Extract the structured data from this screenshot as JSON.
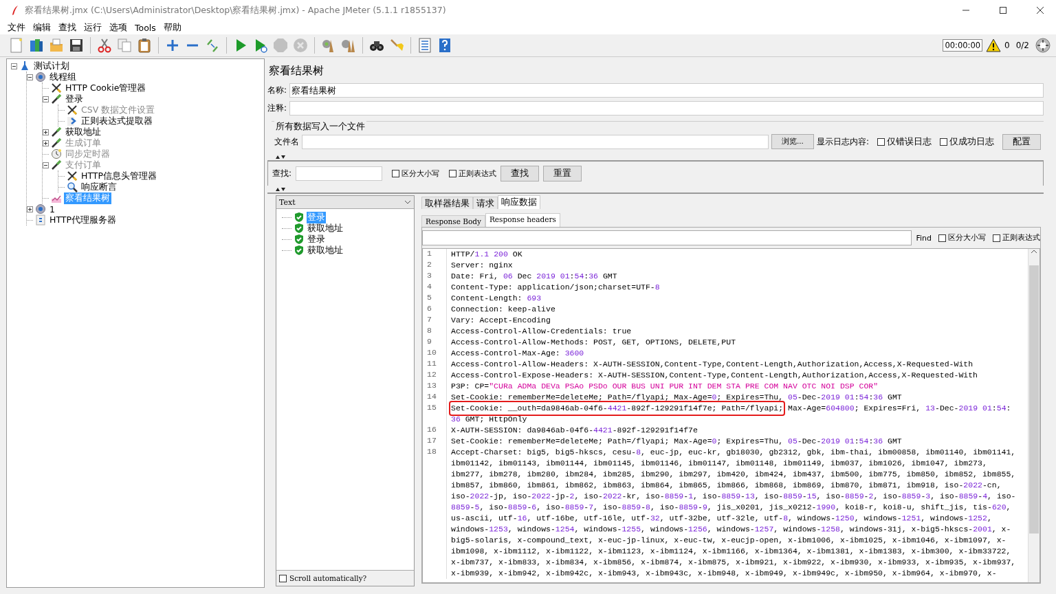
{
  "window": {
    "title": "察看结果树.jmx (C:\\Users\\Administrator\\Desktop\\察看结果树.jmx) - Apache JMeter (5.1.1 r1855137)"
  },
  "menu": [
    "文件",
    "编辑",
    "查找",
    "运行",
    "选项",
    "Tools",
    "帮助"
  ],
  "toolbar": [
    {
      "kind": "new",
      "disabled": false
    },
    {
      "kind": "templates",
      "disabled": false
    },
    {
      "kind": "open",
      "disabled": false
    },
    {
      "kind": "save",
      "disabled": false
    },
    {
      "kind": "separator"
    },
    {
      "kind": "cut",
      "disabled": false
    },
    {
      "kind": "copy",
      "disabled": false
    },
    {
      "kind": "paste",
      "disabled": false
    },
    {
      "kind": "separator"
    },
    {
      "kind": "expand",
      "disabled": false
    },
    {
      "kind": "collapse",
      "disabled": false
    },
    {
      "kind": "toggle",
      "disabled": false
    },
    {
      "kind": "separator"
    },
    {
      "kind": "start",
      "disabled": false
    },
    {
      "kind": "start-no-pauses",
      "disabled": false
    },
    {
      "kind": "stop",
      "disabled": true
    },
    {
      "kind": "shutdown",
      "disabled": true
    },
    {
      "kind": "separator"
    },
    {
      "kind": "clear",
      "disabled": false
    },
    {
      "kind": "clear-all",
      "disabled": false
    },
    {
      "kind": "separator"
    },
    {
      "kind": "search",
      "disabled": false
    },
    {
      "kind": "reset",
      "disabled": false
    },
    {
      "kind": "separator"
    },
    {
      "kind": "function-helper",
      "disabled": false
    },
    {
      "kind": "help",
      "disabled": false
    }
  ],
  "status": {
    "timer": "00:00:00",
    "errors": "0",
    "threads": "0/2"
  },
  "tree": [
    {
      "label": "测试计划",
      "kind": "plan",
      "disabled": false,
      "selected": false,
      "expanded": true,
      "children": [
        {
          "label": "线程组",
          "kind": "thread",
          "disabled": false,
          "selected": false,
          "expanded": true,
          "children": [
            {
              "label": "HTTP Cookie管理器",
              "kind": "config",
              "disabled": false,
              "selected": false
            },
            {
              "label": "登录",
              "kind": "sampler",
              "disabled": false,
              "selected": false,
              "expanded": true,
              "children": [
                {
                  "label": "CSV 数据文件设置",
                  "kind": "config",
                  "disabled": true,
                  "selected": false
                },
                {
                  "label": "正则表达式提取器",
                  "kind": "extractor",
                  "disabled": false,
                  "selected": false
                }
              ]
            },
            {
              "label": "获取地址",
              "kind": "sampler",
              "disabled": false,
              "selected": false,
              "expanded": false
            },
            {
              "label": "生成订单",
              "kind": "sampler",
              "disabled": true,
              "selected": false,
              "expanded": false
            },
            {
              "label": "同步定时器",
              "kind": "timer",
              "disabled": true,
              "selected": false
            },
            {
              "label": "支付订单",
              "kind": "sampler",
              "disabled": true,
              "selected": false,
              "expanded": true,
              "children": [
                {
                  "label": "HTTP信息头管理器",
                  "kind": "config",
                  "disabled": false,
                  "selected": false
                },
                {
                  "label": "响应断言",
                  "kind": "assertion",
                  "disabled": false,
                  "selected": false
                }
              ]
            },
            {
              "label": "察看结果树",
              "kind": "listener",
              "disabled": false,
              "selected": true
            }
          ]
        },
        {
          "label": "1",
          "kind": "thread",
          "disabled": false,
          "selected": false,
          "expanded": false
        },
        {
          "label": "HTTP代理服务器",
          "kind": "proxy",
          "disabled": false,
          "selected": false
        }
      ]
    }
  ],
  "panel": {
    "title": "察看结果树",
    "name_label": "名称:",
    "name_value": "察看结果树",
    "comment_label": "注释:",
    "file_group": {
      "title": "所有数据写入一个文件",
      "filename_label": "文件名",
      "browse": "浏览...",
      "log_label": "显示日志内容:",
      "checkboxes": [
        {
          "label": "仅错误日志",
          "checked": false
        },
        {
          "label": "仅成功日志",
          "checked": false
        }
      ],
      "config": "配置"
    },
    "search": {
      "label": "查找:",
      "checkboxes": [
        {
          "label": "区分大小写",
          "checked": false
        },
        {
          "label": "正则表达式",
          "checked": false
        }
      ],
      "buttons": [
        "查找",
        "重置"
      ]
    }
  },
  "results": {
    "renderer": "Text",
    "items": [
      {
        "label": "登录",
        "selected": true
      },
      {
        "label": "获取地址",
        "selected": false
      },
      {
        "label": "登录",
        "selected": false
      },
      {
        "label": "获取地址",
        "selected": false
      }
    ],
    "scroll": {
      "label": "Scroll automatically?",
      "checked": false
    }
  },
  "tabs": [
    {
      "label": "取样器结果",
      "selected": false
    },
    {
      "label": "请求",
      "selected": false
    },
    {
      "label": "响应数据",
      "selected": true
    }
  ],
  "subtabs": [
    {
      "label": "Response Body",
      "selected": false
    },
    {
      "label": "Response headers",
      "selected": true
    }
  ],
  "find": {
    "label": "Find",
    "checkboxes": [
      {
        "label": "区分大小写",
        "checked": false
      },
      {
        "label": "正则表达式",
        "checked": false
      }
    ]
  },
  "lines": [
    {
      "num": "1",
      "rows": [
        "HTTP/1.1 200 OK"
      ]
    },
    {
      "num": "2",
      "rows": [
        "Server: nginx"
      ]
    },
    {
      "num": "3",
      "rows": [
        "Date: Fri, 06 Dec 2019 01:54:36 GMT"
      ]
    },
    {
      "num": "4",
      "rows": [
        "Content-Type: application/json;charset=UTF-8"
      ]
    },
    {
      "num": "5",
      "rows": [
        "Content-Length: 693"
      ]
    },
    {
      "num": "6",
      "rows": [
        "Connection: keep-alive"
      ]
    },
    {
      "num": "7",
      "rows": [
        "Vary: Accept-Encoding"
      ]
    },
    {
      "num": "8",
      "rows": [
        "Access-Control-Allow-Credentials: true"
      ]
    },
    {
      "num": "9",
      "rows": [
        "Access-Control-Allow-Methods: POST, GET, OPTIONS, DELETE,PUT"
      ]
    },
    {
      "num": "10",
      "rows": [
        "Access-Control-Max-Age: 3600"
      ]
    },
    {
      "num": "11",
      "rows": [
        "Access-Control-Allow-Headers: X-AUTH-SESSION,Content-Type,Content-Length,Authorization,Access,X-Requested-With"
      ]
    },
    {
      "num": "12",
      "rows": [
        "Access-Control-Expose-Headers: X-AUTH-SESSION,Content-Type,Content-Length,Authorization,Access,X-Requested-With"
      ]
    },
    {
      "num": "13",
      "rows": [
        "P3P: CP=\"CURa ADMa DEVa PSAo PSDo OUR BUS UNI PUR INT DEM STA PRE COM NAV OTC NOI DSP COR\""
      ]
    },
    {
      "num": "14",
      "rows": [
        "Set-Cookie: rememberMe=deleteMe; Path=/flyapi; Max-Age=0; Expires=Thu, 05-Dec-2019 01:54:36 GMT"
      ]
    },
    {
      "num": "15",
      "marked": "Set-Cookie: __outh=da9846ab-04f6-4421-892f-129291f14f7e; Path=/flyapi;",
      "rows": [
        " Max-Age=604800; Expires=Fri, 13-Dec-2019 01:54:",
        "36 GMT; HttpOnly"
      ]
    },
    {
      "num": "16",
      "rows": [
        "X-AUTH-SESSION: da9846ab-04f6-4421-892f-129291f14f7e"
      ]
    },
    {
      "num": "17",
      "rows": [
        "Set-Cookie: rememberMe=deleteMe; Path=/flyapi; Max-Age=0; Expires=Thu, 05-Dec-2019 01:54:36 GMT"
      ]
    },
    {
      "num": "18",
      "rows": [
        "Accept-Charset: big5, big5-hkscs, cesu-8, euc-jp, euc-kr, gb18030, gb2312, gbk, ibm-thai, ibm00858, ibm01140, ibm01141,",
        "ibm01142, ibm01143, ibm01144, ibm01145, ibm01146, ibm01147, ibm01148, ibm01149, ibm037, ibm1026, ibm1047, ibm273,",
        "ibm277, ibm278, ibm280, ibm284, ibm285, ibm290, ibm297, ibm420, ibm424, ibm437, ibm500, ibm775, ibm850, ibm852, ibm855,",
        "ibm857, ibm860, ibm861, ibm862, ibm863, ibm864, ibm865, ibm866, ibm868, ibm869, ibm870, ibm871, ibm918, iso-2022-cn,",
        "iso-2022-jp, iso-2022-jp-2, iso-2022-kr, iso-8859-1, iso-8859-13, iso-8859-15, iso-8859-2, iso-8859-3, iso-8859-4, iso-",
        "8859-5, iso-8859-6, iso-8859-7, iso-8859-8, iso-8859-9, jis_x0201, jis_x0212-1990, koi8-r, koi8-u, shift_jis, tis-620,",
        "us-ascii, utf-16, utf-16be, utf-16le, utf-32, utf-32be, utf-32le, utf-8, windows-1250, windows-1251, windows-1252,",
        "windows-1253, windows-1254, windows-1255, windows-1256, windows-1257, windows-1258, windows-31j, x-big5-hkscs-2001, x-",
        "big5-solaris, x-compound_text, x-euc-jp-linux, x-euc-tw, x-eucjp-open, x-ibm1006, x-ibm1025, x-ibm1046, x-ibm1097, x-",
        "ibm1098, x-ibm1112, x-ibm1122, x-ibm1123, x-ibm1124, x-ibm1166, x-ibm1364, x-ibm1381, x-ibm1383, x-ibm300, x-ibm33722,",
        "x-ibm737, x-ibm833, x-ibm834, x-ibm856, x-ibm874, x-ibm875, x-ibm921, x-ibm922, x-ibm930, x-ibm933, x-ibm935, x-ibm937,",
        "x-ibm939, x-ibm942, x-ibm942c, x-ibm943, x-ibm943c, x-ibm948, x-ibm949, x-ibm949c, x-ibm950, x-ibm964, x-ibm970, x-"
      ]
    }
  ]
}
